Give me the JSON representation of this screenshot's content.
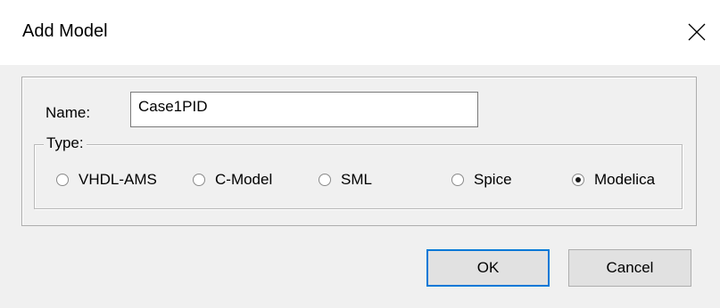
{
  "dialog": {
    "title": "Add Model",
    "close_icon": "close-icon"
  },
  "form": {
    "name_label": "Name:",
    "name_value": "Case1PID",
    "type_label": "Type:",
    "type_options": [
      {
        "label": "VHDL-AMS",
        "selected": false
      },
      {
        "label": "C-Model",
        "selected": false
      },
      {
        "label": "SML",
        "selected": false
      },
      {
        "label": "Spice",
        "selected": false
      },
      {
        "label": "Modelica",
        "selected": true
      }
    ]
  },
  "buttons": {
    "ok_label": "OK",
    "cancel_label": "Cancel"
  }
}
